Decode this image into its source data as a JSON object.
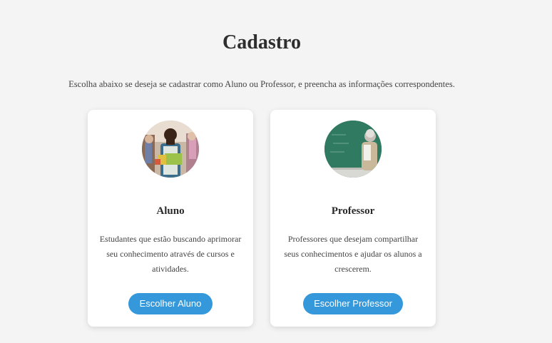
{
  "page": {
    "title": "Cadastro",
    "intro": "Escolha abaixo se deseja se cadastrar como Aluno ou Professor, e preencha as informações correspondentes."
  },
  "cards": [
    {
      "title": "Aluno",
      "description": "Estudantes que estão buscando aprimorar seu conhecimento através de cursos e atividades.",
      "button_label": "Escolher Aluno",
      "image": "student-photo"
    },
    {
      "title": "Professor",
      "description": "Professores que desejam compartilhar seus conhecimentos e ajudar os alunos a crescerem.",
      "button_label": "Escolher Professor",
      "image": "teacher-photo"
    }
  ],
  "colors": {
    "accent": "#3498db",
    "background": "#f4f4f4",
    "card": "#ffffff"
  }
}
